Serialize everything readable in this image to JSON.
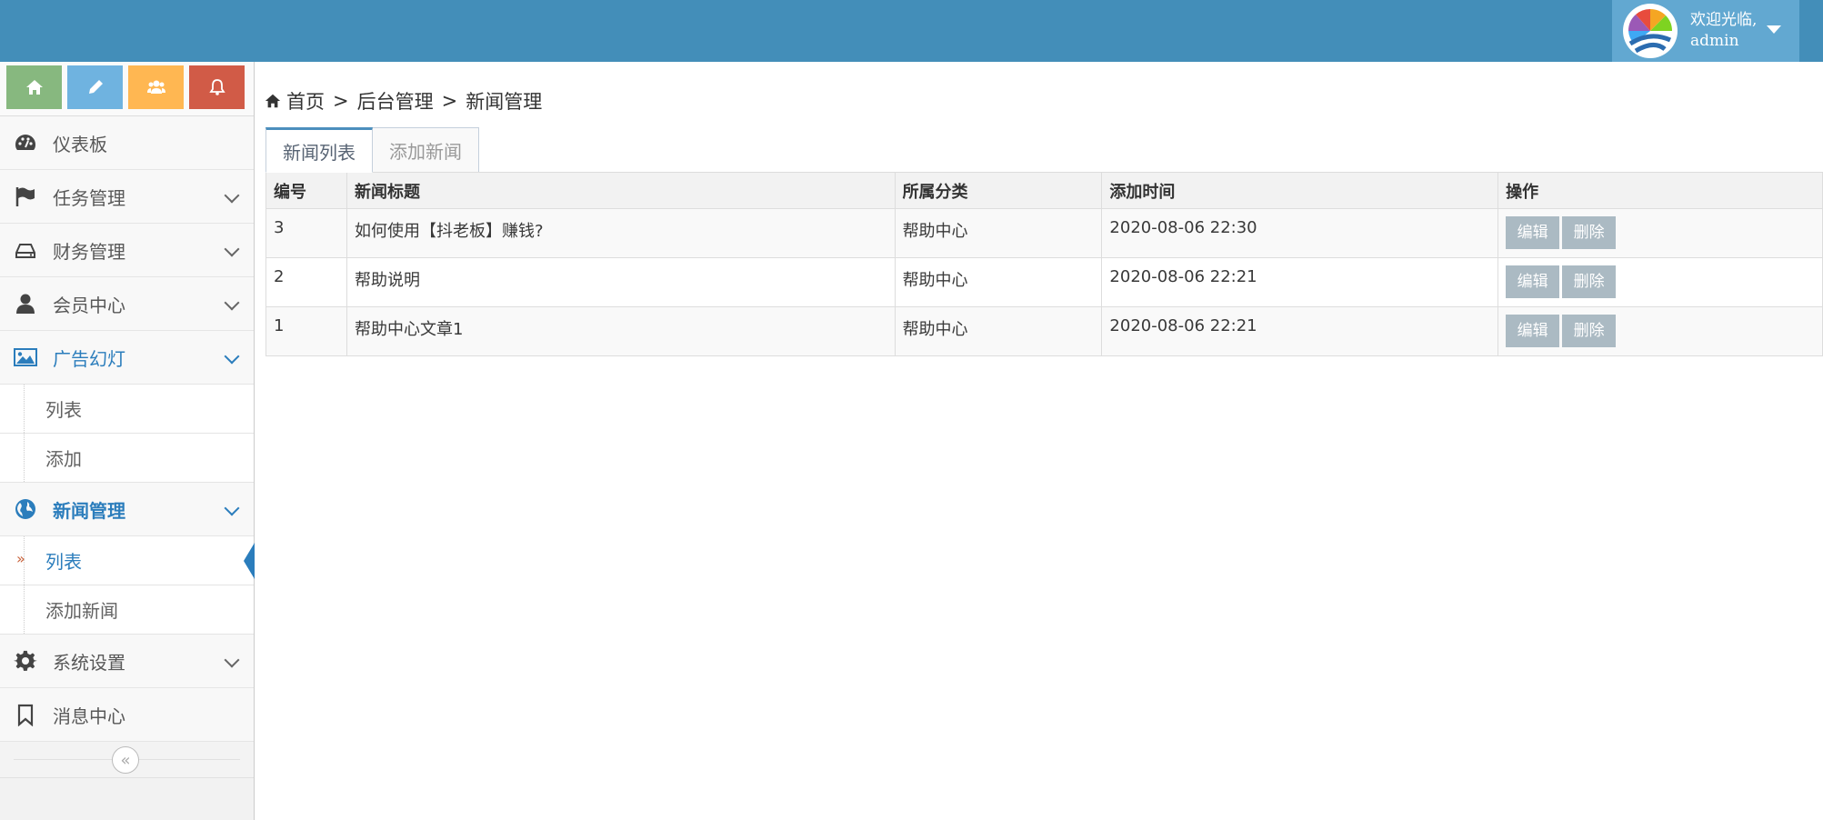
{
  "header": {
    "welcome": "欢迎光临,",
    "username": "admin"
  },
  "shortcuts": [
    {
      "icon": "home-icon",
      "color": "#87b87f"
    },
    {
      "icon": "pencil-icon",
      "color": "#6fb3e0"
    },
    {
      "icon": "users-icon",
      "color": "#ffb752"
    },
    {
      "icon": "bell-icon",
      "color": "#d15b47"
    }
  ],
  "sidebar": {
    "dashboard": "仪表板",
    "tasks": "任务管理",
    "finance": "财务管理",
    "members": "会员中心",
    "ads": "广告幻灯",
    "ads_list": "列表",
    "ads_add": "添加",
    "news": "新闻管理",
    "news_list": "列表",
    "news_add": "添加新闻",
    "settings": "系统设置",
    "messages": "消息中心"
  },
  "breadcrumb": {
    "home": "首页",
    "sep": ">",
    "admin": "后台管理",
    "current": "新闻管理"
  },
  "tabs": {
    "list": "新闻列表",
    "add": "添加新闻"
  },
  "table": {
    "headers": [
      "编号",
      "新闻标题",
      "所属分类",
      "添加时间",
      "操作"
    ],
    "rows": [
      {
        "id": "3",
        "title": "如何使用【抖老板】赚钱?",
        "category": "帮助中心",
        "time": "2020-08-06 22:30"
      },
      {
        "id": "2",
        "title": "帮助说明",
        "category": "帮助中心",
        "time": "2020-08-06 22:21"
      },
      {
        "id": "1",
        "title": "帮助中心文章1",
        "category": "帮助中心",
        "time": "2020-08-06 22:21"
      }
    ],
    "edit_label": "编辑",
    "delete_label": "删除"
  },
  "colors": {
    "navbar": "#438eb9",
    "accent": "#2b7dbc",
    "button": "#abbac3"
  }
}
